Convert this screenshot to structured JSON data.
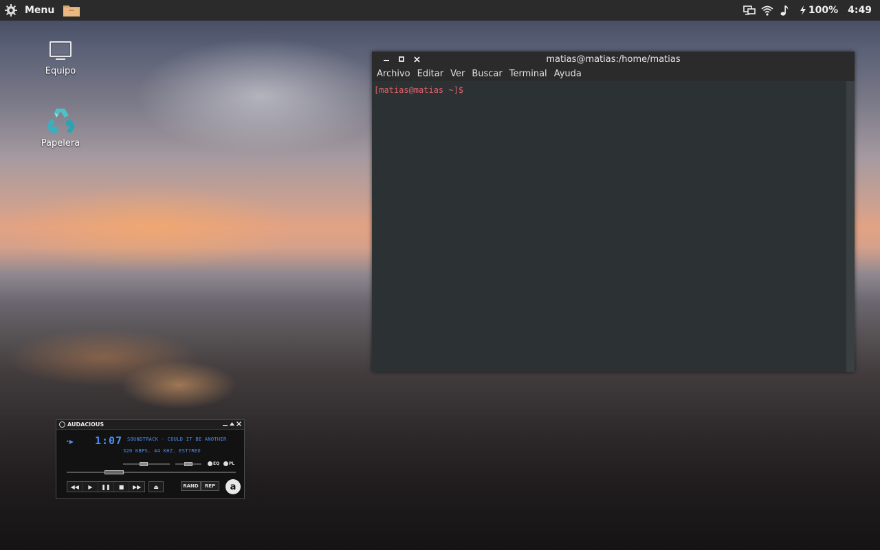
{
  "panel": {
    "menu_label": "Menu",
    "battery_text": "100%",
    "clock": "4:49"
  },
  "desktop": {
    "icons": [
      {
        "label": "Equipo",
        "icon": "computer-icon"
      },
      {
        "label": "Papelera",
        "icon": "recycle-bin-icon"
      }
    ]
  },
  "terminal": {
    "title": "matias@matias:/home/matias",
    "menu": [
      "Archivo",
      "Editar",
      "Ver",
      "Buscar",
      "Terminal",
      "Ayuda"
    ],
    "prompt": "[matias@matias ~]$",
    "colors": {
      "background": "#2c3133",
      "prompt": "#e0636b"
    }
  },
  "audacious": {
    "title": "AUDACIOUS",
    "time": "1:07",
    "song": "SOUNDTRACK - COULD IT BE ANOTHER",
    "info": "320 KBPS. 44 KHZ. EST?REO",
    "eq_label": "EQ",
    "pl_label": "PL",
    "rand_label": "RAND",
    "rep_label": "REP",
    "logo_letter": "a",
    "accent_color": "#4e8ff0"
  }
}
